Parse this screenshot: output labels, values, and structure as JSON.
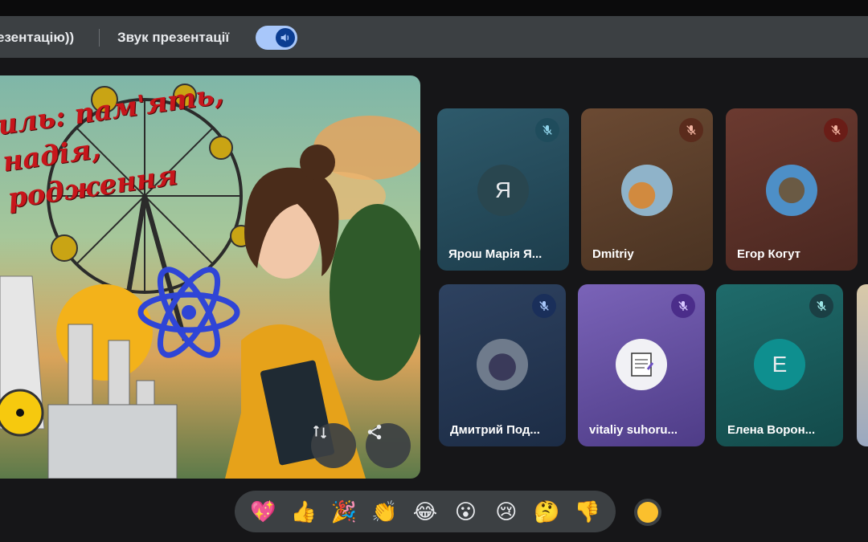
{
  "presentation_bar": {
    "title": "езентацію))",
    "sound_label": "Звук презентації",
    "sound_toggle_on": true
  },
  "slide": {
    "title_lines": "иль: пам'ять,\nнадія,\nродження"
  },
  "participants": [
    {
      "name": "Ярош Марія Я...",
      "initial": "Я",
      "muted": true
    },
    {
      "name": "Dmitriy",
      "initial": "",
      "muted": true
    },
    {
      "name": "Егор Когут",
      "initial": "",
      "muted": true
    },
    {
      "name": "Дмитрий Под...",
      "initial": "",
      "muted": true
    },
    {
      "name": "vitaliy suhoru...",
      "initial": "",
      "muted": true
    },
    {
      "name": "Елена Ворон...",
      "initial": "E",
      "muted": true
    }
  ],
  "reactions": [
    "💖",
    "👍",
    "🎉",
    "👏",
    "😂",
    "😮",
    "😢",
    "🤔",
    "👎"
  ],
  "colors": {
    "accent": "#a8c7fa",
    "background": "#202124",
    "skin_tone": "#fbc02d"
  }
}
